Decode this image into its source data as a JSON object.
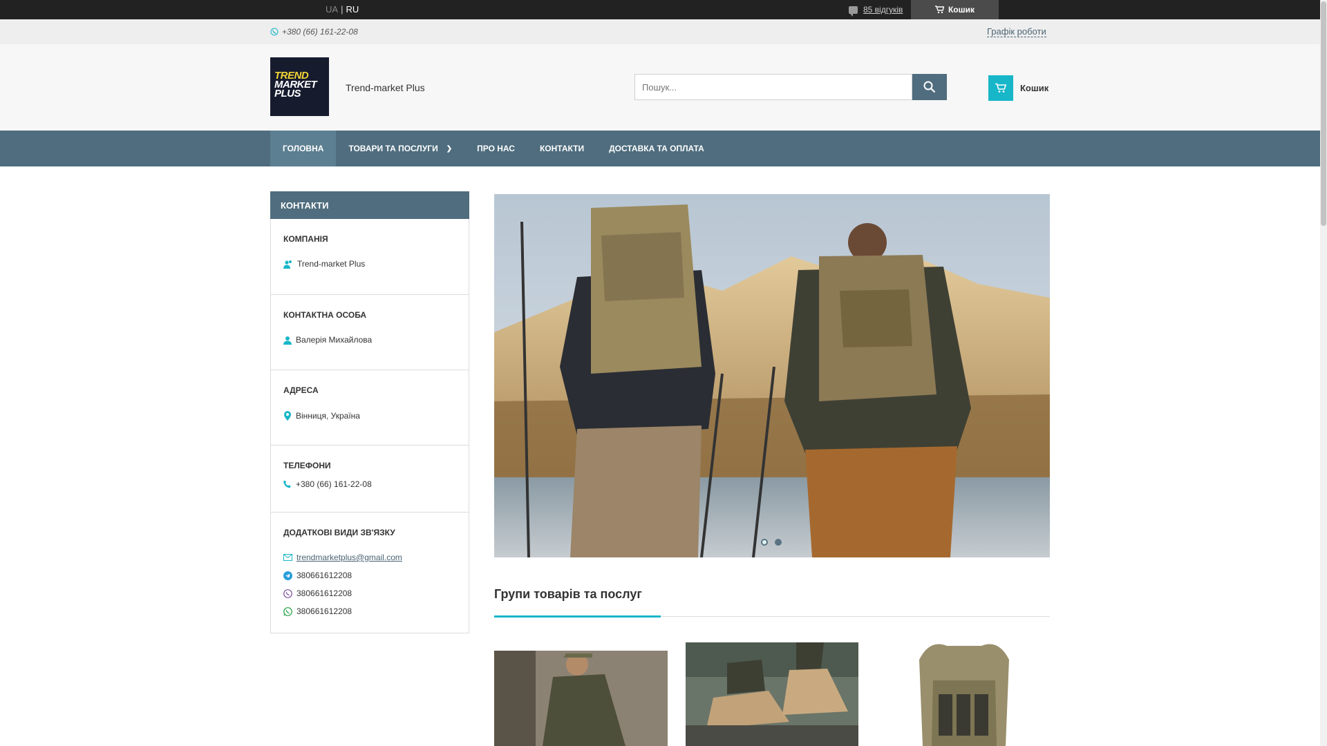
{
  "topbar": {
    "lang_ua": "UA",
    "lang_sep": "|",
    "lang_ru": "RU",
    "reviews": "85 відгуків",
    "cart": "Кошик"
  },
  "infobar": {
    "phone": "+380 (66) 161-22-08",
    "schedule": "Графік роботи"
  },
  "header": {
    "logo_line1": "TREND",
    "logo_line2": "MARKET",
    "logo_line3": "PLUS",
    "site_name": "Trend-market Plus",
    "search_placeholder": "Пошук...",
    "cart_label": "Кошик"
  },
  "nav": {
    "items": [
      {
        "label": "ГОЛОВНА"
      },
      {
        "label": "ТОВАРИ ТА ПОСЛУГИ"
      },
      {
        "label": "ПРО НАС"
      },
      {
        "label": "КОНТАКТИ"
      },
      {
        "label": "ДОСТАВКА ТА ОПЛАТА"
      }
    ]
  },
  "sidebar": {
    "heading": "КОНТАКТИ",
    "company_title": "КОМПАНІЯ",
    "company_name": "Trend-market Plus",
    "person_title": "КОНТАКТНА ОСОБА",
    "person_name": "Валерія Михайлова",
    "address_title": "АДРЕСА",
    "address": "Вінниця, Україна",
    "phones_title": "ТЕЛЕФОНИ",
    "phone": "+380 (66) 161-22-08",
    "extra_title": "ДОДАТКОВІ ВИДИ ЗВ'ЯЗКУ",
    "email": "trendmarketplus@gmail.com",
    "telegram": "380661612208",
    "viber": "380661612208",
    "whatsapp": "380661612208"
  },
  "groups": {
    "title": "Групи товарів та послуг"
  },
  "colors": {
    "nav": "#4f6d7e",
    "accent": "#18b6c9",
    "topbar": "#222222"
  }
}
